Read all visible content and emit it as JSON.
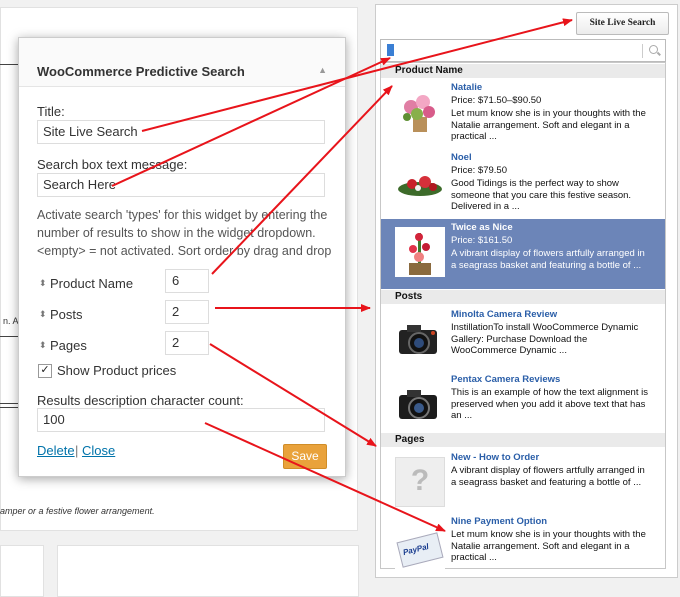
{
  "widget": {
    "title": "WooCommerce Predictive Search",
    "title_field_label": "Title:",
    "title_field_value": "Site Live Search",
    "search_message_label": "Search box text message:",
    "search_message_value": "Search Here",
    "activation_description": "Activate search 'types' for this widget by entering the number of results to show in the widget dropdown. <empty> = not activated. Sort order by drag and drop",
    "types": [
      {
        "label": "Product Name",
        "value": "6"
      },
      {
        "label": "Posts",
        "value": "2"
      },
      {
        "label": "Pages",
        "value": "2"
      }
    ],
    "show_prices_label": "Show Product prices",
    "show_prices_checked": true,
    "char_count_label": "Results description character count:",
    "char_count_value": "100",
    "delete_label": "Delete",
    "separator": "|",
    "close_label": "Close",
    "save_label": "Save"
  },
  "background": {
    "partial_text": "n. A",
    "footer_text": "amper or a festive flower arrangement."
  },
  "live_search": {
    "button_label": "Site Live Search",
    "sections": [
      {
        "title": "Product Name",
        "items": [
          {
            "name": "Natalie",
            "price": "Price: $71.50–$90.50",
            "desc": "Let mum know she is in your thoughts with the Natalie arrangement. Soft and elegant in a practical ...",
            "thumb": "flower-bouquet"
          },
          {
            "name": "Noel",
            "price": "Price: $79.50",
            "desc": "Good Tidings is the perfect way to show someone that you care this festive season. Delivered in a ...",
            "thumb": "christmas-arrangement"
          },
          {
            "name": "Twice as Nice",
            "price": "Price: $161.50",
            "desc": "A vibrant display of flowers artfully arranged in a seagrass basket and featuring a bottle of ...",
            "thumb": "flower-basket",
            "highlighted": true
          }
        ]
      },
      {
        "title": "Posts",
        "items": [
          {
            "name": "Minolta Camera Review",
            "desc": "InstillationTo install WooCommerce Dynamic Gallery: Purchase Download the WooCommerce Dynamic ...",
            "thumb": "camera"
          },
          {
            "name": "Pentax Camera Reviews",
            "desc": "This is an example of how the text alignment is preserved when you add it above text that has an ...",
            "thumb": "camera"
          }
        ]
      },
      {
        "title": "Pages",
        "items": [
          {
            "name": "New - How to Order",
            "desc": "A vibrant display of flowers artfully arranged in a seagrass basket and featuring a bottle of ...",
            "thumb": "placeholder-question"
          },
          {
            "name": "Nine Payment Option",
            "desc": "Let mum know she is in your thoughts with the Natalie arrangement. Soft and elegant in a practical ...",
            "thumb": "paypal-card"
          }
        ]
      }
    ],
    "placeholder_glyph": "?",
    "paypal_text": "PayPal"
  },
  "colors": {
    "link": "#0073aa",
    "save_button": "#e9a23b",
    "highlight_row": "#6c85b8",
    "item_title": "#2a5ea8",
    "annotation_arrow": "#e8141b"
  }
}
